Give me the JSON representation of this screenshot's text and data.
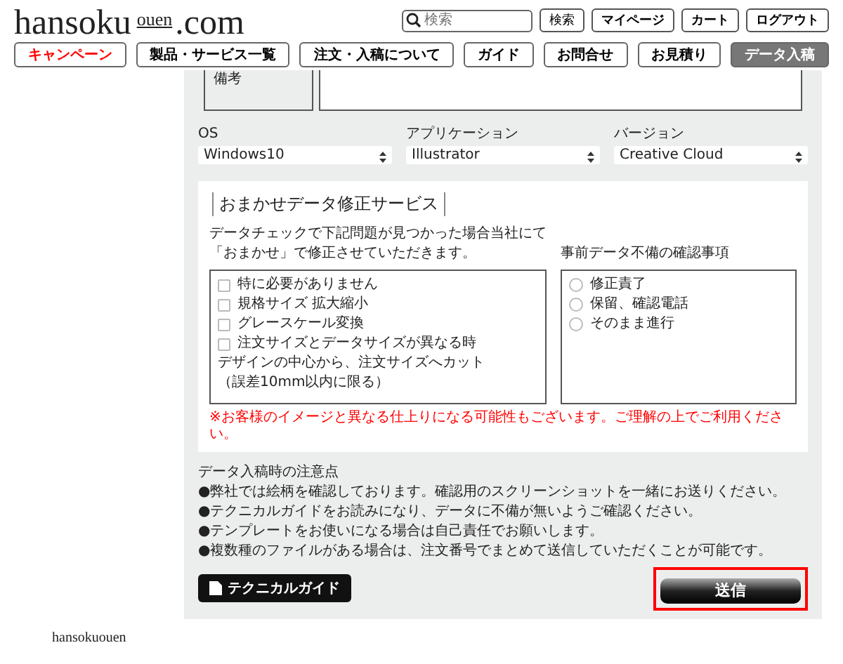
{
  "header": {
    "logo": {
      "main": "hansoku",
      "sub": "ouen",
      "tld": ".com"
    },
    "search": {
      "placeholder": "検索"
    },
    "buttons": [
      "検索",
      "マイページ",
      "カート",
      "ログアウト"
    ]
  },
  "nav": [
    {
      "label": "キャンペーン",
      "kind": "campaign",
      "selected": false
    },
    {
      "label": "製品・サービス一覧",
      "kind": "normal",
      "selected": false
    },
    {
      "label": "注文・入稿について",
      "kind": "normal",
      "selected": false
    },
    {
      "label": "ガイド",
      "kind": "normal",
      "selected": false
    },
    {
      "label": "お問合せ",
      "kind": "normal",
      "selected": false
    },
    {
      "label": "お見積り",
      "kind": "normal",
      "selected": false
    },
    {
      "label": "データ入稿",
      "kind": "normal",
      "selected": true
    }
  ],
  "remark": {
    "label": "備考"
  },
  "selects": [
    {
      "label": "OS",
      "value": "Windows10"
    },
    {
      "label": "アプリケーション",
      "value": "Illustrator"
    },
    {
      "label": "バージョン",
      "value": "Creative Cloud"
    }
  ],
  "service": {
    "title": "おまかせデータ修正サービス",
    "intro": [
      "データチェックで下記問題が見つかった場合当社にて",
      "「おまかせ」で修正させていただきます。"
    ],
    "options": [
      {
        "kind": "checkbox",
        "label": "特に必要がありません",
        "checked": false
      },
      {
        "kind": "checkbox",
        "label": "規格サイズ 拡大縮小",
        "checked": false
      },
      {
        "kind": "checkbox",
        "label": "グレースケール変換",
        "checked": false
      },
      {
        "kind": "checkbox",
        "label": "注文サイズとデータサイズが異なる時",
        "checked": false
      },
      {
        "kind": "text",
        "label": "デザインの中心から、注文サイズへカット"
      },
      {
        "kind": "text",
        "label": "（誤差10mm以内に限る）"
      }
    ],
    "confirm_label": "事前データ不備の確認事項",
    "radios": [
      {
        "label": "修正責了",
        "selected": false
      },
      {
        "label": "保留、確認電話",
        "selected": false
      },
      {
        "label": "そのまま進行",
        "selected": false
      }
    ],
    "warning": "※お客様のイメージと異なる仕上りになる可能性もございます。ご理解の上でご利用ください。"
  },
  "notes": {
    "title": "データ入稿時の注意点",
    "items": [
      "●弊社では絵柄を確認しております。確認用のスクリーンショットを一緒にお送りください。",
      "●テクニカルガイドをお読みになり、データに不備が無いようご確認ください。",
      "●テンプレートをお使いになる場合は自己責任でお願いします。",
      "●複数種のファイルがある場合は、注文番号でまとめて送信していただくことが可能です。"
    ]
  },
  "guide_button": "テクニカルガイド",
  "submit_button": "送信",
  "footer": "hansokuouen"
}
